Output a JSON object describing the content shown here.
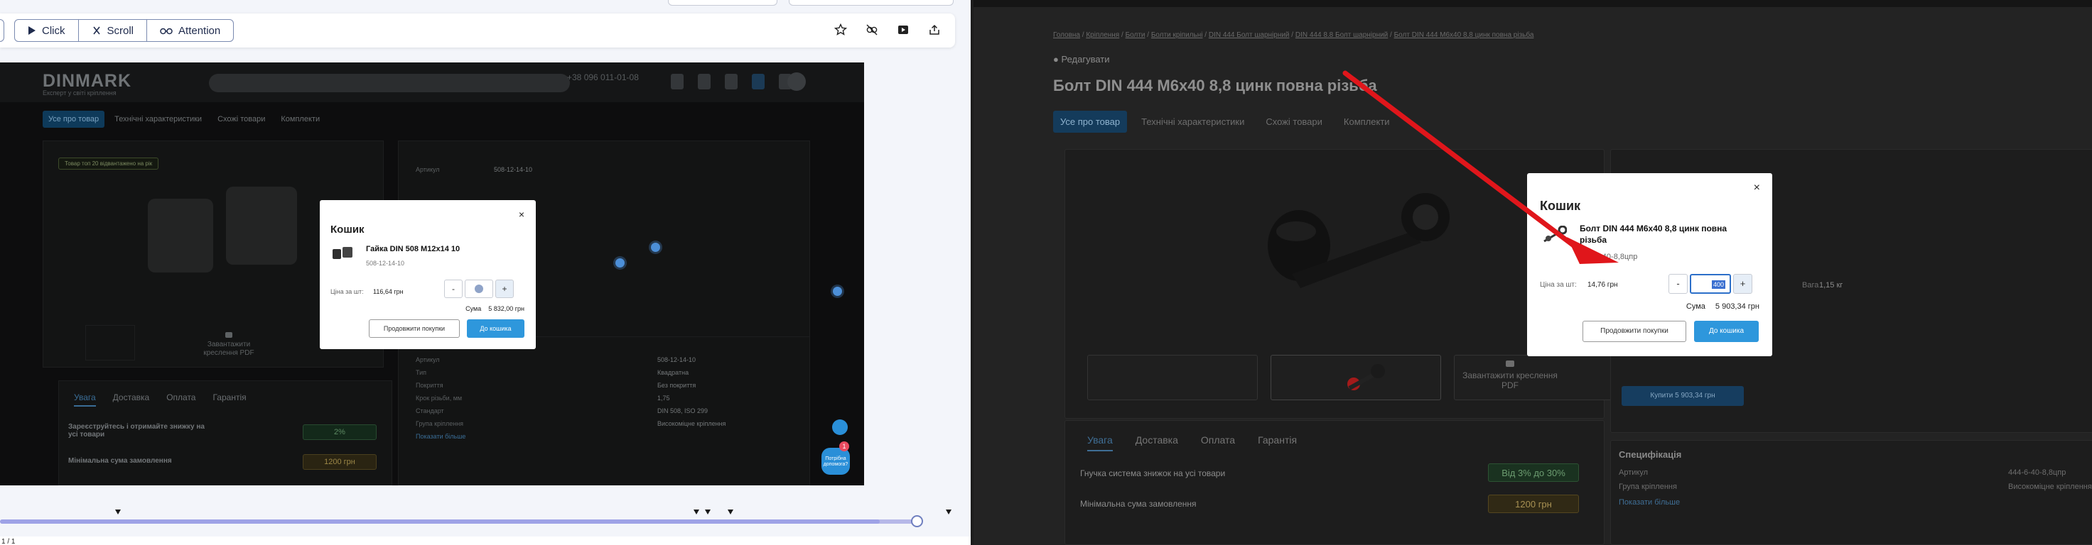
{
  "toolbar": {
    "click_label": "Click",
    "scroll_label": "Scroll",
    "attention_label": "Attention"
  },
  "embedded_page": {
    "logo": "DINMARK",
    "logo_sub": "Експерт у світі кріплення",
    "phone": "+38 096 011-01-08",
    "tabs": [
      "Усе про товар",
      "Технічні характеристики",
      "Схожі товари",
      "Комплекти"
    ],
    "stock_badge": "Товар топ 20 відвантажено на рік",
    "article_label": "Артикул",
    "article_value": "508-12-14-10",
    "pdf_label": "Завантажити креслення PDF",
    "attrs": [
      {
        "label": "Артикул",
        "value": "508-12-14-10"
      },
      {
        "label": "Тип",
        "value": "Квадратна"
      },
      {
        "label": "Покриття",
        "value": "Без покриття"
      },
      {
        "label": "Крок різьби, мм",
        "value": "1,75"
      },
      {
        "label": "Стандарт",
        "value": "DIN 508, ISO 299"
      },
      {
        "label": "Група кріплення",
        "value": "Високоміцне кріплення"
      }
    ],
    "more_link": "Показати більше",
    "bottom_tabs": [
      "Увага",
      "Доставка",
      "Оплата",
      "Гарантія"
    ],
    "discount_text": "Зареєструйтесь і отримайте знижку на усі товари",
    "discount_value": "2%",
    "min_order_label": "Мінімальна сума замовлення",
    "min_order_value": "1200 грн",
    "help_label": "Потрібна допомога?",
    "help_badge": "1"
  },
  "cart_small": {
    "title": "Кошик",
    "close": "×",
    "product_name": "Гайка DIN 508 M12x14 10",
    "sku": "508-12-14-10",
    "price_label": "Ціна за шт:",
    "price": "116,64 грн",
    "minus": "-",
    "plus": "+",
    "sum_label": "Сума",
    "sum_value": "5 832,00 грн",
    "continue_label": "Продовжити покупки",
    "cart_label": "До кошика"
  },
  "timeline": {
    "progress": 0.96
  },
  "bottom_strip_text": "1 / 1",
  "right_page": {
    "breadcrumb": [
      "Головна",
      "Кріплення",
      "Болти",
      "Болти кріпильні",
      "DIN 444 Болт шарнірний",
      "DIN 444 8.8 Болт шарнірний",
      "Болт DIN 444 M6x40 8,8 цинк повна різьба"
    ],
    "edit_label": "Редагувати",
    "title": "Болт DIN 444 M6x40 8,8 цинк повна різьба",
    "tabs": [
      "Усе про товар",
      "Технічні характеристики",
      "Схожі товари",
      "Комплекти"
    ],
    "pdf_label": "Завантажити креслення PDF",
    "bottom_tabs": [
      "Увага",
      "Доставка",
      "Оплата",
      "Гарантія"
    ],
    "discount_text": "Гнучка система знижок на усі товари",
    "discount_value": "Від 3% до 30%",
    "min_order_label": "Мінімальна сума замовлення",
    "min_order_value": "1200 грн",
    "weight_label": "Вага",
    "weight_value": "1,15 кг",
    "buy_label": "Купити 5 903,34 грн",
    "spec_title": "Специфікація",
    "spec_rows": [
      {
        "label": "Артикул",
        "value": "444-6-40-8,8цпр"
      },
      {
        "label": "Група кріплення",
        "value": "Високоміцне кріплення"
      }
    ],
    "more_link": "Показати більше"
  },
  "cart_big": {
    "title": "Кошик",
    "close": "×",
    "product_name": "Болт DIN 444 M6x40 8,8 цинк повна різьба",
    "sku": "444-6-40-8,8цпр",
    "price_label": "Ціна за шт:",
    "price": "14,76 грн",
    "minus": "-",
    "qty": "400",
    "plus": "+",
    "sum_label": "Сума",
    "sum_value": "5 903,34 грн",
    "continue_label": "Продовжити покупки",
    "cart_label": "До кошика"
  },
  "colors": {
    "accent": "#2e97dc",
    "annotation_arrow": "#e0161b",
    "timeline": "#9ea2e6"
  }
}
